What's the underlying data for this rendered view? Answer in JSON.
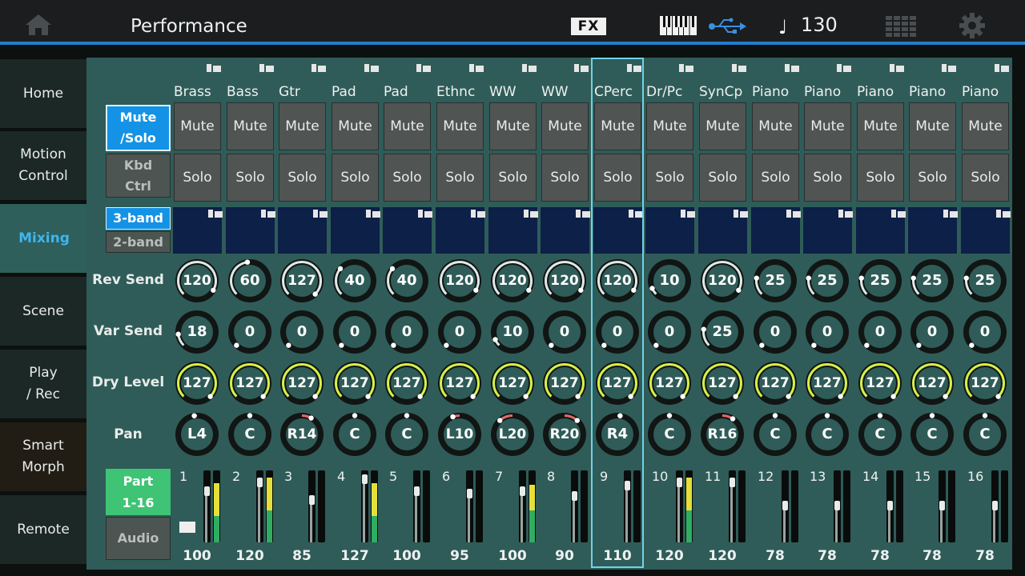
{
  "header": {
    "title": "Performance",
    "fx_label": "FX",
    "tempo": "130",
    "icons": [
      "home-icon",
      "keyboard-icon",
      "usb-icon",
      "note-icon",
      "grid-icon",
      "gear-icon"
    ]
  },
  "sidebar": {
    "items": [
      {
        "label": "Home",
        "active": false
      },
      {
        "label": "Motion\nControl",
        "active": false
      },
      {
        "label": "Mixing",
        "active": true
      },
      {
        "label": "Scene",
        "active": false
      },
      {
        "label": "Play\n/ Rec",
        "active": false
      },
      {
        "label": "Smart\nMorph",
        "active": false
      },
      {
        "label": "Remote",
        "active": false
      }
    ]
  },
  "controls": {
    "mute_solo": "Mute\n/Solo",
    "kbd_ctrl": "Kbd\nCtrl",
    "band3": "3-band",
    "band2": "2-band",
    "part": "Part\n1-16",
    "audio": "Audio",
    "mute_label": "Mute",
    "solo_label": "Solo"
  },
  "row_labels": {
    "rev_send": "Rev Send",
    "var_send": "Var Send",
    "dry_level": "Dry Level",
    "pan": "Pan"
  },
  "colors": {
    "accent_blue": "#1493e6",
    "panel": "#2f5c58",
    "knob_ring_white": "#dfe8e6",
    "knob_ring_yellow": "#d6f04a",
    "pan_red": "#e06a6a",
    "selected_outline": "#6fd3e6"
  },
  "parts": [
    {
      "num": "1",
      "name": "Brass",
      "rev": "120",
      "var": "18",
      "dry": "127",
      "pan": "L4",
      "vol": "100",
      "lvl": 0.82,
      "yel": 0.55,
      "fader": 0.78,
      "kbd": true
    },
    {
      "num": "2",
      "name": "Bass",
      "rev": "60",
      "var": "0",
      "dry": "127",
      "pan": "C",
      "vol": "120",
      "lvl": 0.9,
      "yel": 0.5,
      "fader": 0.9,
      "kbd": false
    },
    {
      "num": "3",
      "name": "Gtr",
      "rev": "127",
      "var": "0",
      "dry": "127",
      "pan": "R14",
      "vol": "85",
      "lvl": 0.0,
      "yel": 0,
      "fader": 0.66,
      "kbd": false
    },
    {
      "num": "4",
      "name": "Pad",
      "rev": "40",
      "var": "0",
      "dry": "127",
      "pan": "C",
      "vol": "127",
      "lvl": 0.82,
      "yel": 0.55,
      "fader": 0.95,
      "kbd": false
    },
    {
      "num": "5",
      "name": "Pad",
      "rev": "40",
      "var": "0",
      "dry": "127",
      "pan": "C",
      "vol": "100",
      "lvl": 0.0,
      "yel": 0,
      "fader": 0.78,
      "kbd": false
    },
    {
      "num": "6",
      "name": "Ethnc",
      "rev": "120",
      "var": "0",
      "dry": "127",
      "pan": "L10",
      "vol": "95",
      "lvl": 0.0,
      "yel": 0,
      "fader": 0.74,
      "kbd": false
    },
    {
      "num": "7",
      "name": "WW",
      "rev": "120",
      "var": "10",
      "dry": "127",
      "pan": "L20",
      "vol": "100",
      "lvl": 0.8,
      "yel": 0.45,
      "fader": 0.78,
      "kbd": false
    },
    {
      "num": "8",
      "name": "WW",
      "rev": "120",
      "var": "0",
      "dry": "127",
      "pan": "R20",
      "vol": "90",
      "lvl": 0.0,
      "yel": 0,
      "fader": 0.71,
      "kbd": false
    },
    {
      "num": "9",
      "name": "CPerc",
      "rev": "120",
      "var": "0",
      "dry": "127",
      "pan": "R4",
      "vol": "110",
      "lvl": 0.0,
      "yel": 0,
      "fader": 0.86,
      "kbd": false
    },
    {
      "num": "10",
      "name": "Dr/Pc",
      "rev": "10",
      "var": "0",
      "dry": "127",
      "pan": "C",
      "vol": "120",
      "lvl": 0.9,
      "yel": 0.5,
      "fader": 0.9,
      "kbd": false
    },
    {
      "num": "11",
      "name": "SynCp",
      "rev": "120",
      "var": "25",
      "dry": "127",
      "pan": "R16",
      "vol": "120",
      "lvl": 0.0,
      "yel": 0,
      "fader": 0.9,
      "kbd": false
    },
    {
      "num": "12",
      "name": "Piano",
      "rev": "25",
      "var": "0",
      "dry": "127",
      "pan": "C",
      "vol": "78",
      "lvl": 0.0,
      "yel": 0,
      "fader": 0.58,
      "kbd": false
    },
    {
      "num": "13",
      "name": "Piano",
      "rev": "25",
      "var": "0",
      "dry": "127",
      "pan": "C",
      "vol": "78",
      "lvl": 0.0,
      "yel": 0,
      "fader": 0.58,
      "kbd": false
    },
    {
      "num": "14",
      "name": "Piano",
      "rev": "25",
      "var": "0",
      "dry": "127",
      "pan": "C",
      "vol": "78",
      "lvl": 0.0,
      "yel": 0,
      "fader": 0.58,
      "kbd": false
    },
    {
      "num": "15",
      "name": "Piano",
      "rev": "25",
      "var": "0",
      "dry": "127",
      "pan": "C",
      "vol": "78",
      "lvl": 0.0,
      "yel": 0,
      "fader": 0.58,
      "kbd": false
    },
    {
      "num": "16",
      "name": "Piano",
      "rev": "25",
      "var": "0",
      "dry": "127",
      "pan": "C",
      "vol": "78",
      "lvl": 0.0,
      "yel": 0,
      "fader": 0.58,
      "kbd": false
    }
  ],
  "selected_part": "9"
}
